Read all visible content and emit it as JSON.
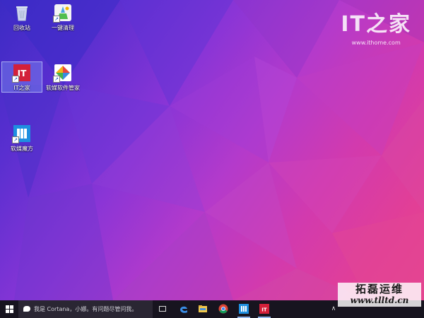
{
  "desktop": {
    "icons": [
      {
        "label": "回收站"
      },
      {
        "label": "一键清理"
      },
      {
        "label": "IT之家"
      },
      {
        "label": "软媒软件管家"
      },
      {
        "label": "软媒魔方"
      }
    ],
    "watermark": {
      "logo": "IT之家",
      "url": "www.ithome.com"
    }
  },
  "taskbar": {
    "search_placeholder": "我是 Cortana，小娜。有问题尽管问我。",
    "apps": [
      {
        "icon": "edge-icon"
      },
      {
        "icon": "file-explorer-icon"
      },
      {
        "icon": "chrome-icon"
      },
      {
        "icon": "ruanmei-cube-icon"
      },
      {
        "icon": "ithome-icon"
      }
    ]
  },
  "overlay_watermark": {
    "line1": "拓磊运维",
    "line2": "www.tlltd.cn"
  },
  "colors": {
    "taskbar": "#17141f",
    "search": "#2a2633",
    "accent_it": "#d3203a",
    "selection": "#8caaff"
  }
}
